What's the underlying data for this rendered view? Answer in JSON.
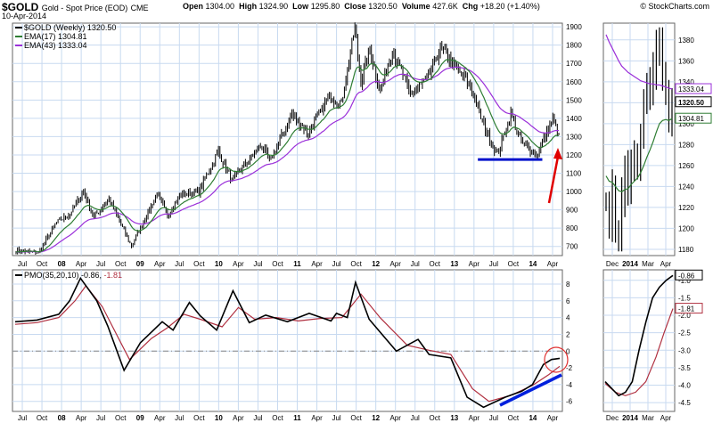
{
  "header": {
    "symbol": "$GOLD",
    "name": "Gold - Spot Price (EOD)",
    "exchange": "CME",
    "date": "10-Apr-2014",
    "open_label": "Open",
    "open": "1304.00",
    "high_label": "High",
    "high": "1324.90",
    "low_label": "Low",
    "low": "1295.80",
    "close_label": "Close",
    "close": "1320.50",
    "volume_label": "Volume",
    "volume": "427.6K",
    "chg_label": "Chg",
    "chg": "+18.20 (+1.40%)",
    "watermark": "© StockCharts.com"
  },
  "chart_data": [
    {
      "type": "line",
      "panel": "price-weekly",
      "legend": [
        "$GOLD (Weekly) 1320.50",
        "EMA(17) 1304.81",
        "EMA(43) 1333.04"
      ],
      "series_names": [
        "$GOLD (Weekly)",
        "EMA(17)",
        "EMA(43)"
      ],
      "ylim": [
        650,
        1920
      ],
      "yticks": [
        700,
        800,
        900,
        1000,
        1100,
        1200,
        1300,
        1400,
        1500,
        1600,
        1700,
        1800,
        1900
      ],
      "xlabels": [
        "Jul",
        "Oct",
        "08",
        "Apr",
        "Jul",
        "Oct",
        "09",
        "Apr",
        "Jul",
        "Oct",
        "10",
        "Apr",
        "Jul",
        "Oct",
        "11",
        "Apr",
        "Jul",
        "Oct",
        "12",
        "Apr",
        "Jul",
        "Oct",
        "13",
        "Apr",
        "Jul",
        "Oct",
        "14",
        "Apr"
      ],
      "x_start": "2007-05-04",
      "x_end": "2014-04-11",
      "price_anchors": [
        [
          "2007-05-04",
          680
        ],
        [
          "2007-08-17",
          665
        ],
        [
          "2007-11-09",
          830
        ],
        [
          "2008-01-11",
          880
        ],
        [
          "2008-03-14",
          1000
        ],
        [
          "2008-05-02",
          860
        ],
        [
          "2008-07-11",
          960
        ],
        [
          "2008-10-24",
          700
        ],
        [
          "2009-02-20",
          990
        ],
        [
          "2009-04-10",
          870
        ],
        [
          "2009-06-05",
          980
        ],
        [
          "2009-09-04",
          1000
        ],
        [
          "2009-12-04",
          1220
        ],
        [
          "2010-02-05",
          1060
        ],
        [
          "2010-06-25",
          1260
        ],
        [
          "2010-07-30",
          1160
        ],
        [
          "2010-11-12",
          1420
        ],
        [
          "2011-01-28",
          1320
        ],
        [
          "2011-05-06",
          1520
        ],
        [
          "2011-07-01",
          1480
        ],
        [
          "2011-09-02",
          1900
        ],
        [
          "2011-09-30",
          1600
        ],
        [
          "2011-11-11",
          1780
        ],
        [
          "2011-12-30",
          1540
        ],
        [
          "2012-02-24",
          1780
        ],
        [
          "2012-05-18",
          1530
        ],
        [
          "2012-08-10",
          1620
        ],
        [
          "2012-10-05",
          1790
        ],
        [
          "2012-12-28",
          1660
        ],
        [
          "2013-02-22",
          1580
        ],
        [
          "2013-04-19",
          1380
        ],
        [
          "2013-06-28",
          1200
        ],
        [
          "2013-08-30",
          1420
        ],
        [
          "2013-10-18",
          1270
        ],
        [
          "2013-12-27",
          1200
        ],
        [
          "2014-03-14",
          1390
        ],
        [
          "2014-04-11",
          1320
        ]
      ],
      "ema17_last": 1304.81,
      "ema43_last": 1333.04,
      "annotations": [
        "support line ~1175 from Apr-2013 to Mar-2014",
        "red arrow pointing up to last price"
      ]
    },
    {
      "type": "line",
      "panel": "price-daily",
      "ylim": [
        1174,
        1396
      ],
      "yticks": [
        1180,
        1200,
        1220,
        1240,
        1260,
        1280,
        1300,
        1320,
        1340,
        1360,
        1380
      ],
      "price_labels": [
        "1333.04",
        "1320.50",
        "1304.81"
      ],
      "xlabels": [
        "Dec",
        "2014",
        "Mar",
        "Apr"
      ],
      "closes": [
        1225,
        1205,
        1240,
        1195,
        1180,
        1230,
        1255,
        1240,
        1265,
        1270,
        1265,
        1290,
        1320,
        1340,
        1330,
        1350,
        1375,
        1388,
        1345,
        1330,
        1300,
        1320
      ],
      "ema17": [
        1250,
        1245,
        1244,
        1240,
        1236,
        1235,
        1237,
        1238,
        1242,
        1245,
        1248,
        1253,
        1260,
        1268,
        1275,
        1283,
        1292,
        1300,
        1303,
        1304,
        1303,
        1304.81
      ],
      "ema43": [
        1385,
        1378,
        1372,
        1366,
        1360,
        1355,
        1352,
        1349,
        1347,
        1345,
        1343,
        1341,
        1340,
        1339,
        1338,
        1338,
        1337,
        1337,
        1336,
        1335,
        1334,
        1333.04
      ]
    },
    {
      "type": "line",
      "panel": "pmo-weekly",
      "legend": "PMO(35,20,10) -0.86, -1.81",
      "legend_values": [
        "-0.86",
        "-1.81"
      ],
      "ylim": [
        -7.2,
        9.7
      ],
      "yticks": [
        -6,
        -4,
        -2,
        0,
        2,
        4,
        6,
        8
      ],
      "zero_line": 0,
      "pmo": [
        [
          0,
          3.5
        ],
        [
          0.04,
          3.7
        ],
        [
          0.08,
          4.4
        ],
        [
          0.1,
          6
        ],
        [
          0.12,
          8.7
        ],
        [
          0.15,
          6
        ],
        [
          0.17,
          3
        ],
        [
          0.2,
          -2.3
        ],
        [
          0.23,
          1
        ],
        [
          0.27,
          3.5
        ],
        [
          0.29,
          2.5
        ],
        [
          0.32,
          5.8
        ],
        [
          0.34,
          4.2
        ],
        [
          0.37,
          2.5
        ],
        [
          0.4,
          7.2
        ],
        [
          0.43,
          3.4
        ],
        [
          0.46,
          4.3
        ],
        [
          0.5,
          3.5
        ],
        [
          0.54,
          4.5
        ],
        [
          0.58,
          3.6
        ],
        [
          0.59,
          4.5
        ],
        [
          0.61,
          4
        ],
        [
          0.625,
          8.2
        ],
        [
          0.65,
          3.8
        ],
        [
          0.7,
          0
        ],
        [
          0.74,
          1.4
        ],
        [
          0.76,
          -0.4
        ],
        [
          0.8,
          -0.8
        ],
        [
          0.83,
          -5.5
        ],
        [
          0.86,
          -6.7
        ],
        [
          0.9,
          -5.5
        ],
        [
          0.93,
          -4.8
        ],
        [
          0.95,
          -4
        ],
        [
          0.97,
          -1.6
        ],
        [
          0.985,
          -1
        ],
        [
          1,
          -0.86
        ]
      ],
      "signal": [
        [
          0,
          3.2
        ],
        [
          0.04,
          3.4
        ],
        [
          0.08,
          4
        ],
        [
          0.11,
          6
        ],
        [
          0.13,
          7.8
        ],
        [
          0.16,
          5.3
        ],
        [
          0.19,
          1.5
        ],
        [
          0.21,
          -1
        ],
        [
          0.25,
          1.5
        ],
        [
          0.28,
          2.8
        ],
        [
          0.31,
          4.4
        ],
        [
          0.34,
          3.8
        ],
        [
          0.38,
          2.9
        ],
        [
          0.41,
          5.2
        ],
        [
          0.44,
          3.8
        ],
        [
          0.48,
          4
        ],
        [
          0.52,
          3.6
        ],
        [
          0.56,
          3.9
        ],
        [
          0.6,
          4
        ],
        [
          0.635,
          6.8
        ],
        [
          0.67,
          4
        ],
        [
          0.72,
          0.7
        ],
        [
          0.76,
          0.1
        ],
        [
          0.8,
          -0.4
        ],
        [
          0.84,
          -4.5
        ],
        [
          0.87,
          -6
        ],
        [
          0.91,
          -5.3
        ],
        [
          0.95,
          -4.1
        ],
        [
          0.98,
          -2.8
        ],
        [
          1,
          -1.81
        ]
      ],
      "annotations": [
        "rising blue trendline on lows",
        "red circle around recent crossover"
      ]
    },
    {
      "type": "line",
      "panel": "pmo-daily",
      "ylim": [
        -4.75,
        -0.7
      ],
      "yticks": [
        -1.0,
        -1.5,
        -2.0,
        -2.5,
        -3.0,
        -3.5,
        -4.0,
        -4.5
      ],
      "value_labels": [
        "-0.86",
        "-1.81"
      ],
      "xlabels": [
        "Dec",
        "2014",
        "Mar",
        "Apr"
      ],
      "pmo": [
        [
          0,
          -3.9
        ],
        [
          0.1,
          -4.1
        ],
        [
          0.2,
          -4.3
        ],
        [
          0.3,
          -4.2
        ],
        [
          0.4,
          -3.9
        ],
        [
          0.5,
          -3.0
        ],
        [
          0.6,
          -2.2
        ],
        [
          0.7,
          -1.5
        ],
        [
          0.8,
          -1.2
        ],
        [
          0.9,
          -1.0
        ],
        [
          1,
          -0.86
        ]
      ],
      "signal": [
        [
          0,
          -3.95
        ],
        [
          0.15,
          -4.2
        ],
        [
          0.3,
          -4.3
        ],
        [
          0.45,
          -4.2
        ],
        [
          0.6,
          -3.9
        ],
        [
          0.75,
          -3.2
        ],
        [
          0.87,
          -2.5
        ],
        [
          1,
          -1.81
        ]
      ]
    }
  ]
}
